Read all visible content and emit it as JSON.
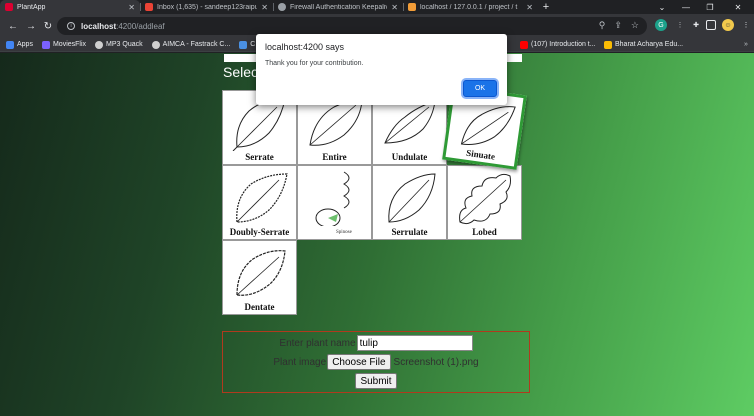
{
  "tabs": [
    {
      "title": "PlantApp",
      "icon": "angular-icon",
      "color": "#dd0031",
      "active": true
    },
    {
      "title": "Inbox (1,635) - sandeep123raipu",
      "icon": "gmail-icon",
      "color": "#ea4335"
    },
    {
      "title": "Firewall Authentication Keepalive",
      "icon": "globe-icon",
      "color": "#9aa0a6"
    },
    {
      "title": "localhost / 127.0.0.1 / project / t",
      "icon": "phpmyadmin-icon",
      "color": "#f29d38"
    }
  ],
  "address_bar": {
    "host": "localhost",
    "path": ":4200/addleaf"
  },
  "bookmarks": [
    {
      "label": "Apps",
      "color": "#4285f4"
    },
    {
      "label": "MoviesFlix",
      "color": "#7b61ff"
    },
    {
      "label": "MP3 Quack",
      "color": "#cfcfcf"
    },
    {
      "label": "AIMCA - Fastrack C...",
      "color": "#cfcfcf"
    },
    {
      "label": "C",
      "color": "#4a90e2"
    },
    {
      "label": "(107) Introduction t...",
      "color": "#ff0000"
    },
    {
      "label": "Bharat Acharya Edu...",
      "color": "#fbbc04"
    }
  ],
  "page": {
    "heading": "Select",
    "leaves": [
      {
        "name": "Serrate"
      },
      {
        "name": "Entire"
      },
      {
        "name": "Undulate"
      },
      {
        "name": "Sinuate",
        "selected": true
      },
      {
        "name": "Doubly-Serrate"
      },
      {
        "name": "",
        "sublabel": "Spinose"
      },
      {
        "name": "Serrulate"
      },
      {
        "name": "Lobed"
      },
      {
        "name": "Dentate"
      }
    ],
    "form": {
      "name_label": "Enter plant name",
      "name_value": "tulip",
      "image_label": "Plant image",
      "choose_file_label": "Choose File",
      "file_name": "Screenshot (1).png",
      "submit_label": "Submit"
    }
  },
  "dialog": {
    "title": "localhost:4200 says",
    "message": "Thank you for your contribution.",
    "ok_label": "OK"
  },
  "colors": {
    "selected_border": "#2e9a35",
    "form_border": "#b03a1e",
    "ok_button": "#1a73e8"
  }
}
